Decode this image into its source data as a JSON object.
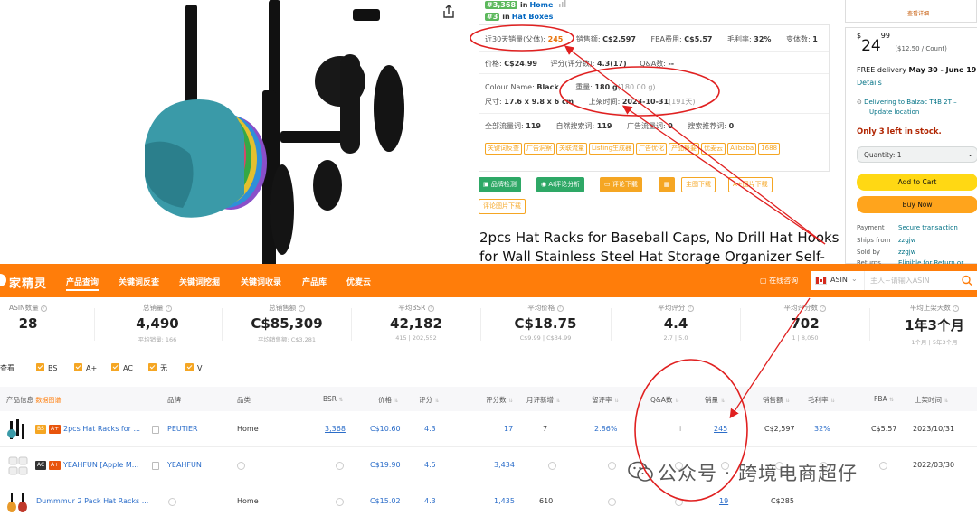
{
  "amazon": {
    "ranks": [
      {
        "badge": "#3,368",
        "in": "in",
        "category": "Home"
      },
      {
        "badge": "#3",
        "in": "in",
        "category": "Hat Boxes"
      }
    ],
    "info": {
      "sales30_label": "近30天销量(父体):",
      "sales30_value": "245",
      "revenue_label": "销售额:",
      "revenue_value": "C$2,597",
      "fba_label": "FBA费用:",
      "fba_value": "C$5.57",
      "margin_label": "毛利率:",
      "margin_value": "32%",
      "variants_label": "变体数:",
      "variants_value": "1",
      "price_label": "价格:",
      "price_value": "C$24.99",
      "rating_label": "评分(评分数):",
      "rating_value": "4.3(17)",
      "qa_label": "Q&A数:",
      "qa_value": "--",
      "colour_label": "Colour Name:",
      "colour_value": "Black",
      "weight_label": "重量:",
      "weight_value": "180 g",
      "weight_extra": "(180.00 g)",
      "size_label": "尺寸:",
      "size_value": "17.6 x 9.8 x 6 cm",
      "launch_label": "上架时间:",
      "launch_value": "2023-10-31",
      "launch_extra": "(191天)",
      "total_kw_label": "全部流量词:",
      "total_kw_value": "119",
      "natural_kw_label": "自然搜索词:",
      "natural_kw_value": "119",
      "ad_kw_label": "广告流量词:",
      "ad_kw_value": "0",
      "rec_kw_label": "搜索推荐词:",
      "rec_kw_value": "0",
      "tags": [
        "关键词反查",
        "广告洞察",
        "关联流量",
        "Listing生成器",
        "广告优化",
        "产品概要",
        "优麦云",
        "Alibaba",
        "1688"
      ]
    },
    "buttons": [
      "品牌检测",
      "AI评论分析",
      "评论下载",
      "主图下载",
      "A+图片下载",
      "评论图片下载"
    ],
    "title": "2pcs Hat Racks for Baseball Caps, No Drill Hat Hooks for Wall Stainless Steel Hat Storage Organizer Self-",
    "buybox": {
      "top_link": "查看详细",
      "price_symbol": "$",
      "price_whole": "24",
      "price_fraction": "99",
      "price_unit": "($12.50 / Count)",
      "delivery_prefix": "FREE delivery",
      "delivery_dates": "May 30 - June 19",
      "details": "Details",
      "deliver_to": "Delivering to Balzac T4B 2T –",
      "update_location": "Update location",
      "stock": "Only 3 left in stock.",
      "quantity": "Quantity: 1",
      "add_to_cart": "Add to Cart",
      "buy_now": "Buy Now",
      "payment_label": "Payment",
      "payment_value": "Secure transaction",
      "ships_label": "Ships from",
      "ships_value": "zzgjw",
      "sold_label": "Sold by",
      "sold_value": "zzgjw",
      "returns_label": "Returns",
      "returns_value": "Eligible for Return or"
    }
  },
  "toolbar": {
    "logo": "家精灵",
    "nav": [
      "产品查询",
      "关键词反查",
      "关键词挖掘",
      "关键词收录",
      "产品库",
      "优麦云"
    ],
    "online_consult": "在线咨询",
    "country": "ASIN",
    "search_placeholder": "主人~请输入ASIN"
  },
  "stats": [
    {
      "label": "ASIN数量",
      "value": "28",
      "sub": ""
    },
    {
      "label": "总销量",
      "value": "4,490",
      "sub": "平均销量: 166"
    },
    {
      "label": "总销售额",
      "value": "C$85,309",
      "sub": "平均销售额: C$3,281"
    },
    {
      "label": "平均BSR",
      "value": "42,182",
      "sub": "415 | 202,552"
    },
    {
      "label": "平均价格",
      "value": "C$18.75",
      "sub": "C$9.99 | C$34.99"
    },
    {
      "label": "平均评分",
      "value": "4.4",
      "sub": "2.7 | 5.0"
    },
    {
      "label": "平均评分数",
      "value": "702",
      "sub": "1 | 8,050"
    },
    {
      "label": "平均上架天数",
      "value": "1年3个月",
      "sub": "1个月 | 5年3个月"
    }
  ],
  "filters": {
    "label": "查看",
    "options": [
      "BS",
      "A+",
      "AC",
      "无",
      "V"
    ]
  },
  "table": {
    "headers": {
      "product": "产品信息",
      "export": "数据图谱",
      "brand": "品牌",
      "category": "品类",
      "bsr": "BSR",
      "price": "价格",
      "rating": "评分",
      "reviews": "评分数",
      "new_reviews": "月评新增",
      "review_rate": "留评率",
      "qa": "Q&A数",
      "sales": "销量",
      "revenue": "销售额",
      "margin": "毛利率",
      "fba": "FBA",
      "launch": "上架时间"
    },
    "rows": [
      {
        "badge1": "BS",
        "badge2": "A+",
        "title": "2pcs Hat Racks for ...",
        "brand": "PEUTIER",
        "category": "Home",
        "bsr": "3,368",
        "price": "C$10.60",
        "rating": "4.3",
        "reviews": "17",
        "new_reviews": "7",
        "review_rate": "2.86%",
        "qa": "i",
        "sales": "245",
        "revenue": "C$2,597",
        "margin": "32%",
        "fba": "C$5.57",
        "launch": "2023/10/31"
      },
      {
        "badge1": "AC",
        "badge2": "A+",
        "title": "YEAHFUN [Apple M...",
        "brand": "YEAHFUN",
        "category": "",
        "bsr": "",
        "price": "C$19.90",
        "rating": "4.5",
        "reviews": "3,434",
        "new_reviews": "",
        "review_rate": "",
        "qa": "",
        "sales": "",
        "revenue": "",
        "margin": "",
        "fba": "",
        "launch": "2022/03/30"
      },
      {
        "badge1": "",
        "badge2": "",
        "title": "Dummmur 2 Pack Hat Racks ...",
        "brand": "",
        "category": "Home",
        "bsr": "",
        "price": "C$15.02",
        "rating": "4.3",
        "reviews": "1,435",
        "new_reviews": "610",
        "review_rate": "",
        "qa": "",
        "sales": "19",
        "revenue": "C$285",
        "margin": "",
        "fba": "",
        "launch": ""
      }
    ]
  },
  "watermark": "公众号 · 跨境电商超仔",
  "colors": {
    "toolbar": "#ff7d0a",
    "annotation_red": "#e02020",
    "link_blue": "#2b6dc9",
    "tag_orange": "#f5a623"
  }
}
